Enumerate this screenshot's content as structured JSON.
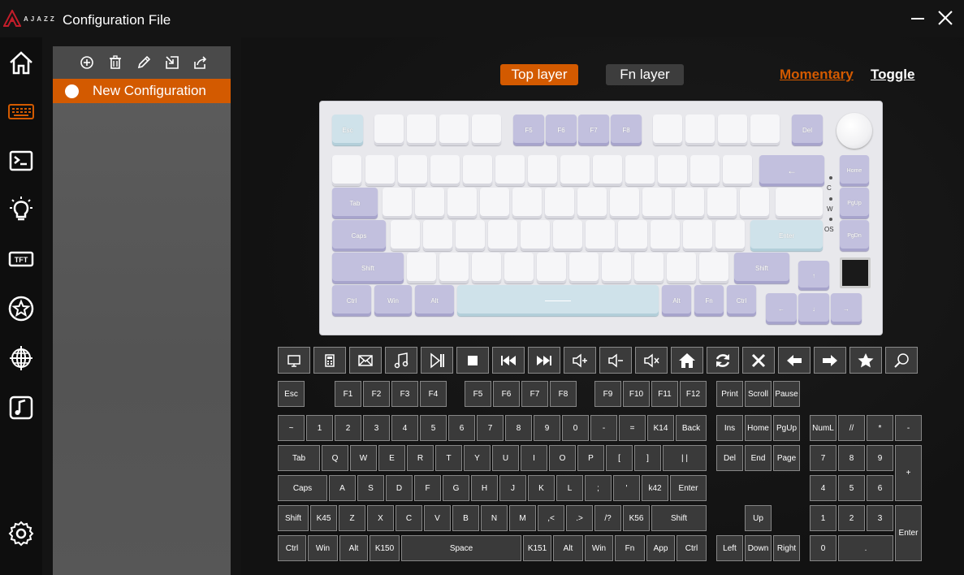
{
  "header": {
    "logo_text": "AJAZZ",
    "title": "Configuration File",
    "minimize_icon": "minimize-icon",
    "close_icon": "close-icon"
  },
  "sidebar": {
    "items": [
      {
        "name": "home",
        "icon": "home-icon"
      },
      {
        "name": "keyboard",
        "icon": "keyboard-icon",
        "active": true
      },
      {
        "name": "macro",
        "icon": "terminal-icon"
      },
      {
        "name": "lighting",
        "icon": "lightbulb-icon"
      },
      {
        "name": "tft",
        "icon": "tft-icon",
        "label": "TFT"
      },
      {
        "name": "favorites",
        "icon": "star-circle-icon"
      },
      {
        "name": "global",
        "icon": "globe-icon"
      },
      {
        "name": "music",
        "icon": "music-icon"
      },
      {
        "name": "settings",
        "icon": "gear-icon"
      }
    ]
  },
  "config_panel": {
    "toolbar": [
      "add-icon",
      "delete-icon",
      "edit-icon",
      "import-icon",
      "export-icon"
    ],
    "items": [
      {
        "label": "New Configuration",
        "selected": true
      }
    ]
  },
  "layers": {
    "top_layer": "Top layer",
    "fn_layer": "Fn layer",
    "momentary": "Momentary",
    "toggle": "Toggle",
    "active_color": "#d35a00",
    "inactive_color": "#3d3d3d"
  },
  "keyboard_image": {
    "legends": {
      "esc": "Esc",
      "f5": "F5",
      "f6": "F6",
      "f7": "F7",
      "f8": "F8",
      "del": "Del",
      "backspace": "←",
      "home": "Home",
      "pgup": "PgUp",
      "pgdn": "PgDn",
      "tab": "Tab",
      "caps": "Caps",
      "enter": "Enter",
      "shift_l": "Shift",
      "shift_r": "Shift",
      "ctrl_l": "Ctrl",
      "win": "Win",
      "alt_l": "Alt",
      "alt_r": "Alt",
      "fn": "Fn",
      "ctrl_r": "Ctrl",
      "up": "↑",
      "left": "←",
      "down": "↓",
      "right": "→"
    },
    "switch_labels": [
      "C",
      "W",
      "OS"
    ]
  },
  "function_icons": [
    "monitor-icon",
    "calculator-icon",
    "mail-icon",
    "music-note-icon",
    "play-pause-icon",
    "stop-icon",
    "previous-track-icon",
    "next-track-icon",
    "volume-up-icon",
    "volume-down-icon",
    "mute-icon",
    "home-page-icon",
    "refresh-icon",
    "cancel-icon",
    "back-arrow-icon",
    "forward-arrow-icon",
    "favorite-star-icon",
    "search-icon"
  ],
  "keys": {
    "esc": "Esc",
    "f": [
      "F1",
      "F2",
      "F3",
      "F4",
      "F5",
      "F6",
      "F7",
      "F8",
      "F9",
      "F10",
      "F11",
      "F12"
    ],
    "print": "Print",
    "scroll": "Scroll",
    "pause": "Pause",
    "num_row": [
      "~",
      "1",
      "2",
      "3",
      "4",
      "5",
      "6",
      "7",
      "8",
      "9",
      "0",
      "-",
      "=",
      "K14",
      "Back"
    ],
    "ins": "Ins",
    "home": "Home",
    "pgup": "PgUp",
    "numl": "NumL",
    "npdiv": "//",
    "npmul": "*",
    "npsub": "-",
    "q_row": [
      "Tab",
      "Q",
      "W",
      "E",
      "R",
      "T",
      "Y",
      "U",
      "I",
      "O",
      "P",
      "[",
      "]",
      "| |"
    ],
    "del": "Del",
    "end": "End",
    "page": "Page",
    "np7": "7",
    "np8": "8",
    "np9": "9",
    "npadd": "+",
    "a_row": [
      "Caps",
      "A",
      "S",
      "D",
      "F",
      "G",
      "H",
      "J",
      "K",
      "L",
      ";",
      "'",
      "k42",
      "Enter"
    ],
    "np4": "4",
    "np5": "5",
    "np6": "6",
    "z_row": [
      "Shift",
      "K45",
      "Z",
      "X",
      "C",
      "V",
      "B",
      "N",
      "M",
      ",<",
      ".>",
      "/?",
      "K56",
      "Shift"
    ],
    "up": "Up",
    "np1": "1",
    "np2": "2",
    "np3": "3",
    "npenter": "Enter",
    "bottom_row": [
      "Ctrl",
      "Win",
      "Alt",
      "K150",
      "Space",
      "K151",
      "Alt",
      "Win",
      "Fn",
      "App",
      "Ctrl"
    ],
    "left": "Left",
    "down": "Down",
    "right": "Right",
    "np0": "0",
    "npdot": "."
  }
}
